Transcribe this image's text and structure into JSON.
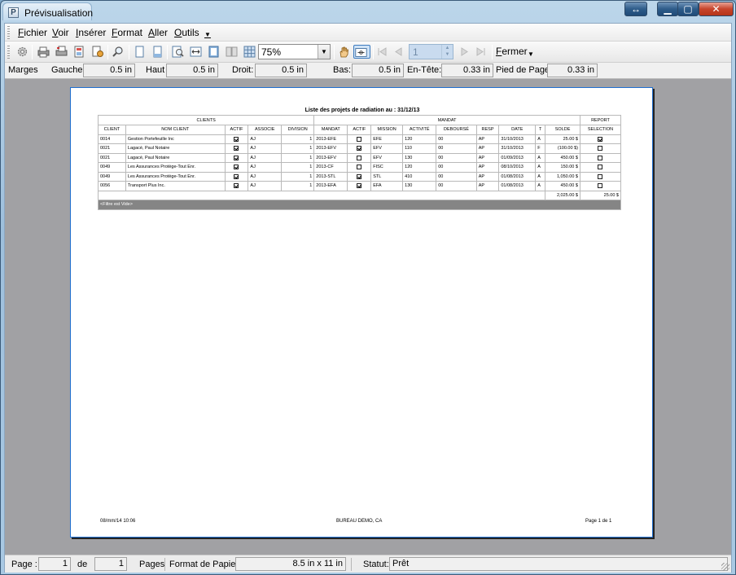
{
  "window": {
    "title": "Prévisualisation"
  },
  "menu": [
    {
      "label": "Fichier"
    },
    {
      "label": "Voir"
    },
    {
      "label": "Insérer"
    },
    {
      "label": "Format"
    },
    {
      "label": "Aller"
    },
    {
      "label": "Outils"
    }
  ],
  "toolbar": {
    "zoom": "75%",
    "page_number": "1",
    "close_label": "Fermer"
  },
  "margins": {
    "title": "Marges",
    "left_label": "Gauche:",
    "left": "0.5 in",
    "top_label": "Haut",
    "top": "0.5 in",
    "right_label": "Droit:",
    "right": "0.5 in",
    "bottom_label": "Bas:",
    "bottom": "0.5 in",
    "header_label": "En-Tête:",
    "header": "0.33 in",
    "footer_label": "Pied de Page:",
    "footer": "0.33 in"
  },
  "report": {
    "title": "Liste des projets de radiation au : 31/12/13",
    "group_clients": "CLIENTS",
    "group_mandat": "MANDAT",
    "group_report": "REPORT",
    "columns": [
      "CLIENT",
      "NOM CLIENT",
      "ACTIF",
      "ASSOCIE",
      "DIVISION",
      "MANDAT",
      "ACTIF",
      "MISSION",
      "ACTIVITÉ",
      "DEBOURSÉ",
      "RESP",
      "DATE",
      "T",
      "SOLDE",
      "SELECTION"
    ],
    "rows": [
      {
        "client": "0014",
        "nom": "Gestion Portefeuille Inc",
        "actif": true,
        "associe": "AJ",
        "division": "1",
        "mandat": "2013-EFE",
        "mactif": false,
        "mission": "EFE",
        "activite": "120",
        "debourse": "00",
        "resp": "AP",
        "date": "31/10/2013",
        "t": "A",
        "solde": "25.00 $",
        "selection": true
      },
      {
        "client": "0021",
        "nom": "Lagacé, Paul Notaire",
        "actif": true,
        "associe": "AJ",
        "division": "1",
        "mandat": "2013-EFV",
        "mactif": true,
        "mission": "EFV",
        "activite": "110",
        "debourse": "00",
        "resp": "AP",
        "date": "31/10/2013",
        "t": "F",
        "solde": "(100.00 $)",
        "selection": false
      },
      {
        "client": "0021",
        "nom": "Lagacé, Paul Notaire",
        "actif": true,
        "associe": "AJ",
        "division": "1",
        "mandat": "2013-EFV",
        "mactif": false,
        "mission": "EFV",
        "activite": "130",
        "debourse": "00",
        "resp": "AP",
        "date": "01/09/2013",
        "t": "A",
        "solde": "450.00 $",
        "selection": false
      },
      {
        "client": "0049",
        "nom": "Les Assurances Protège-Tout Enr.",
        "actif": true,
        "associe": "AJ",
        "division": "1",
        "mandat": "2013-CF",
        "mactif": false,
        "mission": "FISC",
        "activite": "120",
        "debourse": "00",
        "resp": "AP",
        "date": "08/10/2013",
        "t": "A",
        "solde": "150.00 $",
        "selection": false
      },
      {
        "client": "0049",
        "nom": "Les Assurances Protège-Tout Enr.",
        "actif": true,
        "associe": "AJ",
        "division": "1",
        "mandat": "2013-STL",
        "mactif": true,
        "mission": "STL",
        "activite": "410",
        "debourse": "00",
        "resp": "AP",
        "date": "01/08/2013",
        "t": "A",
        "solde": "1,050.00 $",
        "selection": false
      },
      {
        "client": "0056",
        "nom": "Transport Plus Inc.",
        "actif": true,
        "associe": "AJ",
        "division": "1",
        "mandat": "2013-EFA",
        "mactif": true,
        "mission": "EFA",
        "activite": "130",
        "debourse": "00",
        "resp": "AP",
        "date": "01/08/2013",
        "t": "A",
        "solde": "450.00 $",
        "selection": false
      }
    ],
    "total_solde": "2,025.00 $",
    "total_selection": "25.00 $",
    "filter_text": "<Filtre est Vide>",
    "footer_left": "08/mm/14 10:06",
    "footer_center": "BUREAU DEMO, CA",
    "footer_right": "Page  1  de  1"
  },
  "status": {
    "page_label": "Page :",
    "page_value": "1",
    "of_label": "de",
    "pages_value": "1",
    "pages_label": "Pages",
    "paper_label": "Format de Papier:",
    "paper_value": "8.5 in x 11 in",
    "status_label": "Statut:",
    "status_value": "Prêt"
  }
}
